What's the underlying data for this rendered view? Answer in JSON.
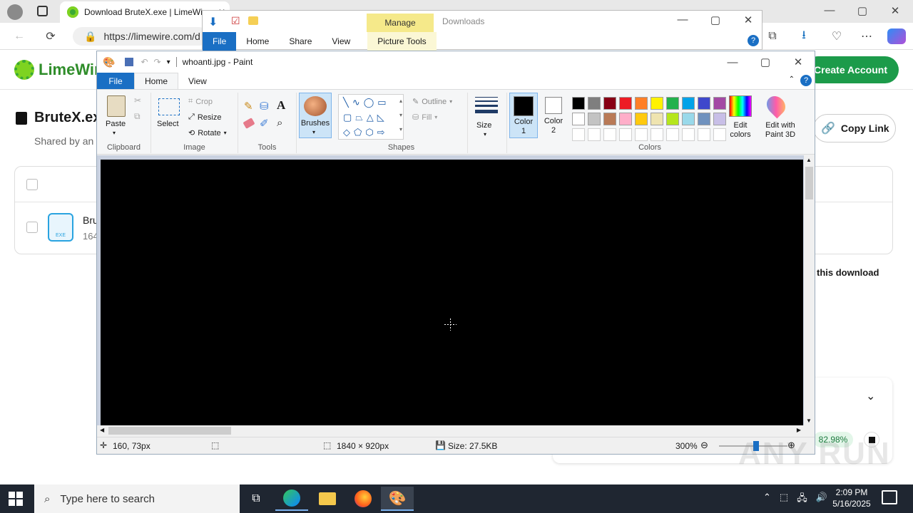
{
  "browser": {
    "tab_title": "Download BruteX.exe | LimeWire",
    "tab_close": "✕",
    "url": "https://limewire.com/d",
    "win_min": "—",
    "win_max": "▢",
    "win_close": "✕"
  },
  "limewire": {
    "logo_text": "LimeWire",
    "create_account": "Create Account",
    "file_title": "BruteX.exe",
    "shared_by": "Shared by an",
    "file_name": "Bru",
    "file_size": "164",
    "exe_label": "EXE",
    "copy_link": "Copy Link",
    "this_download": "this download",
    "progress_pct": "82.98%"
  },
  "explorer": {
    "manage": "Manage",
    "folder_title": "Downloads",
    "tabs": [
      "File",
      "Home",
      "Share",
      "View",
      "Picture Tools"
    ]
  },
  "paint": {
    "title": "whoanti.jpg - Paint",
    "tabs": {
      "file": "File",
      "home": "Home",
      "view": "View"
    },
    "clipboard": {
      "paste": "Paste",
      "label": "Clipboard"
    },
    "image": {
      "select": "Select",
      "crop": "Crop",
      "resize": "Resize",
      "rotate": "Rotate",
      "label": "Image"
    },
    "tools": {
      "label": "Tools"
    },
    "brushes": "Brushes",
    "shapes": {
      "outline": "Outline",
      "fill": "Fill",
      "label": "Shapes"
    },
    "size": "Size",
    "color1": "Color 1",
    "color2": "Color 2",
    "colors_label": "Colors",
    "edit_colors": "Edit colors",
    "edit_paint3d": "Edit with Paint 3D",
    "palette_row1": [
      "#000000",
      "#7f7f7f",
      "#880015",
      "#ed1c24",
      "#ff7f27",
      "#fff200",
      "#22b14c",
      "#00a2e8",
      "#3f48cc",
      "#a349a4"
    ],
    "palette_row2": [
      "#ffffff",
      "#c3c3c3",
      "#b97a57",
      "#ffaec9",
      "#ffc90e",
      "#efe4b0",
      "#b5e61d",
      "#99d9ea",
      "#7092be",
      "#c8bfe7"
    ],
    "status": {
      "cursor_pos": "160, 73px",
      "dimensions": "1840 × 920px",
      "size": "Size: 27.5KB",
      "zoom": "300%"
    }
  },
  "taskbar": {
    "search_placeholder": "Type here to search",
    "time": "2:09 PM",
    "date": "5/16/2025"
  },
  "watermark": "ANY RUN"
}
